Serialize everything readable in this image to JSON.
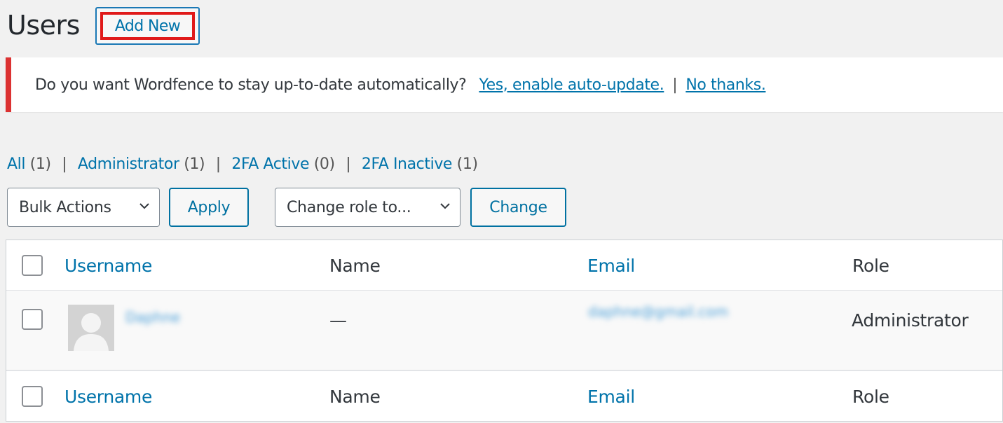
{
  "header": {
    "title": "Users",
    "add_new_label": "Add New"
  },
  "notice": {
    "message": "Do you want Wordfence to stay up-to-date automatically?",
    "yes_link": "Yes, enable auto-update.",
    "separator": "|",
    "no_link": "No thanks."
  },
  "views": [
    {
      "label": "All",
      "count": "(1)"
    },
    {
      "label": "Administrator",
      "count": "(1)"
    },
    {
      "label": "2FA Active",
      "count": "(0)"
    },
    {
      "label": "2FA Inactive",
      "count": "(1)"
    }
  ],
  "controls": {
    "bulk_actions": "Bulk Actions",
    "apply": "Apply",
    "change_role": "Change role to...",
    "change": "Change"
  },
  "table": {
    "columns": [
      "Username",
      "Name",
      "Email",
      "Role"
    ],
    "rows": [
      {
        "username": "Daphne",
        "name": "—",
        "email": "daphne@gmail.com",
        "role": "Administrator"
      }
    ]
  },
  "colors": {
    "accent": "#0073aa",
    "highlight": "#e01a1a",
    "notice_border": "#dc3232"
  },
  "icons": {
    "dropdown": "chevron-down-icon",
    "avatar": "user-silhouette-icon"
  }
}
